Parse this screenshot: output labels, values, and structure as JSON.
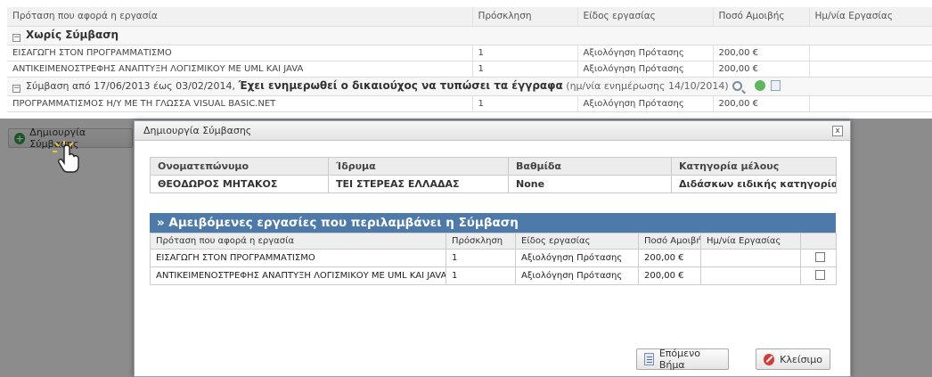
{
  "grid": {
    "columns": [
      "Πρόταση που αφορά η εργασία",
      "Πρόσκληση",
      "Είδος εργασίας",
      "Ποσό Αμοιβής",
      "Ημ/νία Εργασίας"
    ],
    "group1": {
      "title": "Χωρίς Σύμβαση",
      "rows": [
        [
          "ΕΙΣΑΓΩΓΗ ΣΤΟΝ ΠΡΟΓΡΑΜΜΑΤΙΣΜΟ",
          "1",
          "Αξιολόγηση Πρότασης",
          "200,00 €",
          ""
        ],
        [
          "ΑΝΤΙΚΕΙΜΕΝΟΣΤΡΕΦΗΣ ΑΝΑΠΤΥΞΗ ΛΟΓΙΣΜΙΚΟΥ ΜΕ UML ΚΑΙ JAVA",
          "1",
          "Αξιολόγηση Πρότασης",
          "200,00 €",
          ""
        ]
      ]
    },
    "group2": {
      "title_prefix": "Σύμβαση από 17/06/2013 έως 03/02/2014,",
      "title_bold": "Έχει ενημερωθεί ο δικαιούχος να τυπώσει τα έγγραφα",
      "title_suffix": "(ημ/νία ενημέρωσης 14/10/2014)",
      "rows": [
        [
          "ΠΡΟΓΡΑΜΜΑΤΙΣΜΟΣ Η/Υ ΜΕ ΤΗ ΓΛΩΣΣΑ VISUAL BASIC.NET",
          "1",
          "Αξιολόγηση Πρότασης",
          "200,00 €",
          ""
        ]
      ]
    }
  },
  "create_button_label": "Δημιουργία Σύμβασης",
  "dialog": {
    "title": "Δημιουργία Σύμβασης",
    "info_headers": [
      "Ονοματεπώνυμο",
      "Ίδρυμα",
      "Βαθμίδα",
      "Κατηγορία μέλους"
    ],
    "info_values": [
      "ΘΕΟΔΩΡΟΣ ΜΗΤΑΚΟΣ",
      "ΤΕΙ ΣΤΕΡΕΑΣ ΕΛΛΑΔΑΣ",
      "None",
      "Διδάσκων ειδικής κατηγορίας"
    ],
    "paid_title": "» Αμειβόμενες εργασίες που περιλαμβάνει η Σύμβαση",
    "paid_headers": [
      "Πρόταση που αφορά η εργασία",
      "Πρόσκληση",
      "Είδος εργασίας",
      "Ποσό Αμοιβής",
      "Ημ/νία Εργασίας",
      ""
    ],
    "paid_rows": [
      [
        "ΕΙΣΑΓΩΓΗ ΣΤΟΝ ΠΡΟΓΡΑΜΜΑΤΙΣΜΟ",
        "1",
        "Αξιολόγηση Πρότασης",
        "200,00 €",
        ""
      ],
      [
        "ΑΝΤΙΚΕΙΜΕΝΟΣΤΡΕΦΗΣ ΑΝΑΠΤΥΞΗ ΛΟΓΙΣΜΙΚΟΥ ΜΕ UML ΚΑΙ JAVA",
        "1",
        "Αξιολόγηση Πρότασης",
        "200,00 €",
        ""
      ]
    ],
    "next_label": "Επόμενο Βήμα",
    "close_label": "Κλείσιμο",
    "close_glyph": "x"
  }
}
